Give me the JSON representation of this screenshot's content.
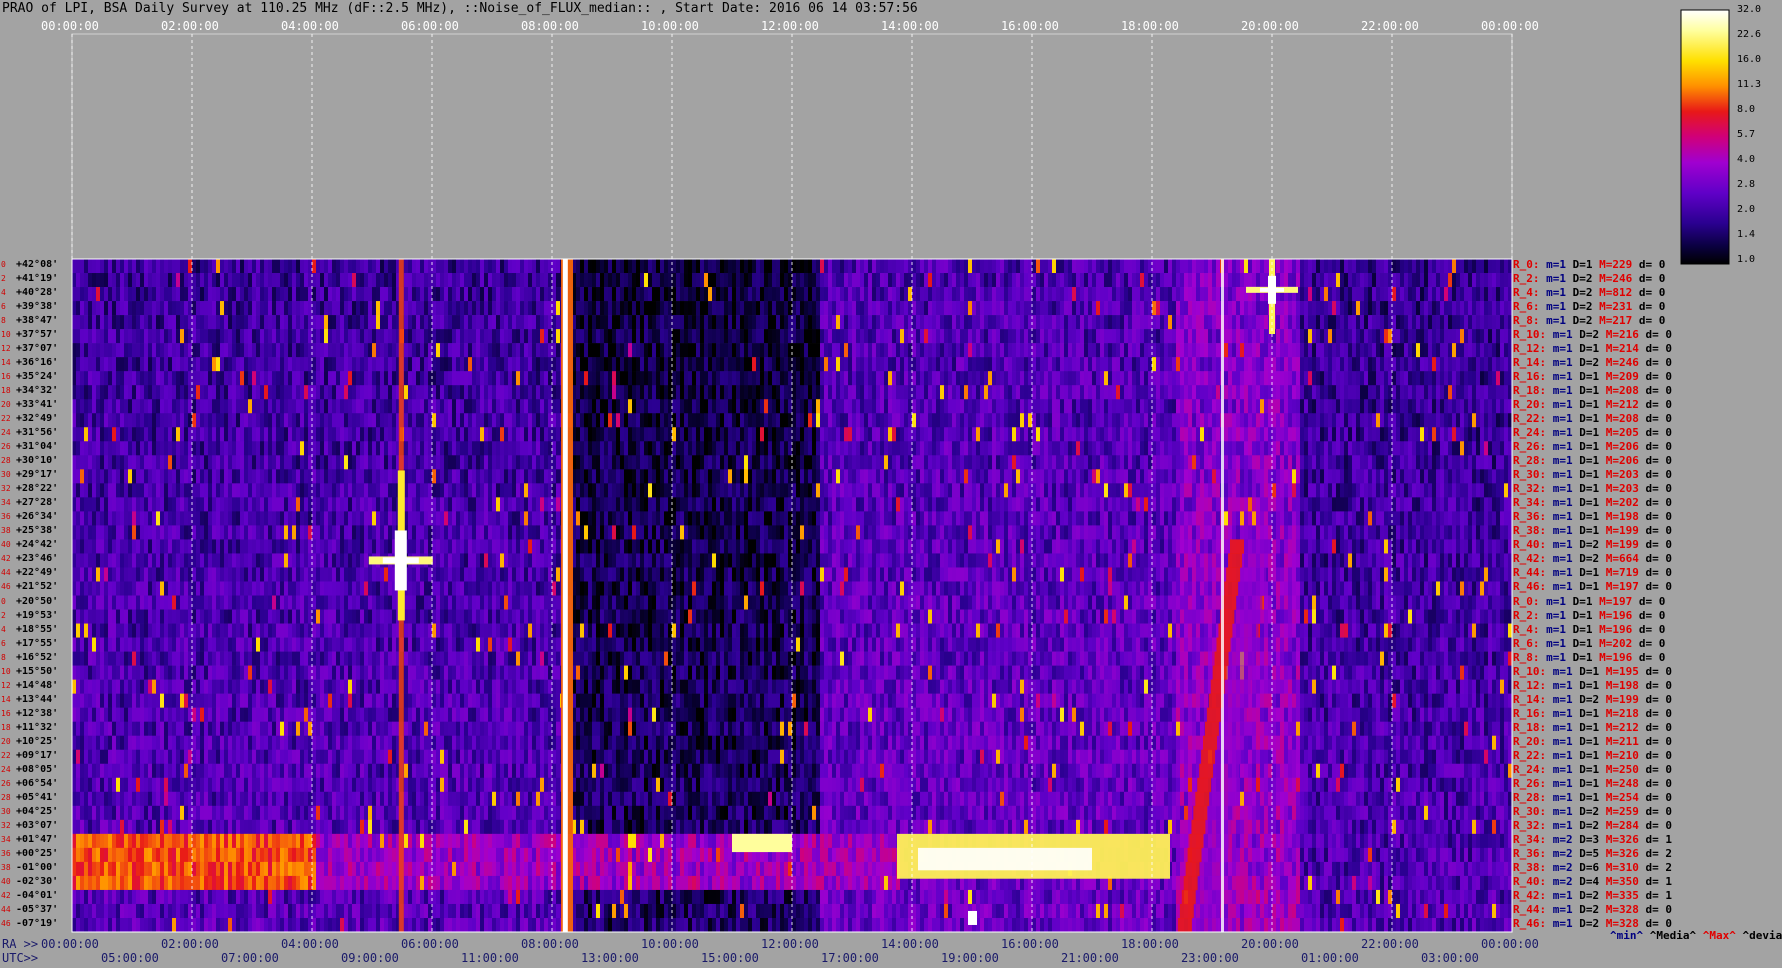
{
  "title": "PRAO of LPI, BSA Daily Survey at 110.25 MHz (dF::2.5 MHz), ::Noise_of_FLUX_median:: , Start Date: 2016 06 14 03:57:56",
  "top_axis_ticks": [
    "00:00:00",
    "02:00:00",
    "04:00:00",
    "06:00:00",
    "08:00:00",
    "10:00:00",
    "12:00:00",
    "14:00:00",
    "16:00:00",
    "18:00:00",
    "20:00:00",
    "22:00:00",
    "00:00:00"
  ],
  "ra_axis": {
    "label": "RA >>",
    "ticks": [
      "00:00:00",
      "02:00:00",
      "04:00:00",
      "06:00:00",
      "08:00:00",
      "10:00:00",
      "12:00:00",
      "14:00:00",
      "16:00:00",
      "18:00:00",
      "20:00:00",
      "22:00:00",
      "00:00:00"
    ]
  },
  "utc_axis": {
    "label": "UTC>>",
    "ticks": [
      "05:00:00",
      "07:00:00",
      "09:00:00",
      "11:00:00",
      "13:00:00",
      "15:00:00",
      "17:00:00",
      "19:00:00",
      "21:00:00",
      "23:00:00",
      "01:00:00",
      "03:00:00"
    ]
  },
  "colorbar": {
    "labels": [
      "32.0",
      "22.6",
      "16.0",
      "11.3",
      "8.0",
      "5.7",
      "4.0",
      "2.8",
      "2.0",
      "1.4",
      "1.0"
    ],
    "colors": [
      "#ffffff",
      "#ffff80",
      "#ffd800",
      "#ff8000",
      "#e01010",
      "#d0007a",
      "#a000d0",
      "#6000c8",
      "#2a0090",
      "#0a0040",
      "#000000"
    ]
  },
  "declinations": [
    "+42°08'",
    "+41°19'",
    "+40°28'",
    "+39°38'",
    "+38°47'",
    "+37°57'",
    "+37°07'",
    "+36°16'",
    "+35°24'",
    "+34°32'",
    "+33°41'",
    "+32°49'",
    "+31°56'",
    "+31°04'",
    "+30°10'",
    "+29°17'",
    "+28°22'",
    "+27°28'",
    "+26°34'",
    "+25°38'",
    "+24°42'",
    "+23°46'",
    "+22°49'",
    "+21°52'",
    "+20°50'",
    "+19°53'",
    "+18°55'",
    "+17°55'",
    "+16°52'",
    "+15°50'",
    "+14°48'",
    "+13°44'",
    "+12°38'",
    "+11°32'",
    "+10°25'",
    "+09°17'",
    "+08°05'",
    "+06°54'",
    "+05°41'",
    "+04°25'",
    "+03°07'",
    "+01°47'",
    "+00°25'",
    "-01°00'",
    "-02°30'",
    "-04°01'",
    "-05°37'",
    "-07°19'"
  ],
  "row_numbers": [
    "0",
    "2",
    "4",
    "6",
    "8",
    "10",
    "12",
    "14",
    "16",
    "18",
    "20",
    "22",
    "24",
    "26",
    "28",
    "30",
    "32",
    "34",
    "36",
    "38",
    "40",
    "42",
    "44",
    "46",
    "0",
    "2",
    "4",
    "6",
    "8",
    "10",
    "12",
    "14",
    "16",
    "18",
    "20",
    "22",
    "24",
    "26",
    "28",
    "30",
    "32",
    "34",
    "36",
    "38",
    "40",
    "42",
    "44",
    "46"
  ],
  "row_stats": [
    {
      "r": "R_0:",
      "m": "m=1",
      "d": "D=1",
      "M": "M=229",
      "dv": "d= 0"
    },
    {
      "r": "R_2:",
      "m": "m=1",
      "d": "D=2",
      "M": "M=246",
      "dv": "d= 0"
    },
    {
      "r": "R_4:",
      "m": "m=1",
      "d": "D=2",
      "M": "M=812",
      "dv": "d= 0"
    },
    {
      "r": "R_6:",
      "m": "m=1",
      "d": "D=2",
      "M": "M=231",
      "dv": "d= 0"
    },
    {
      "r": "R_8:",
      "m": "m=1",
      "d": "D=2",
      "M": "M=217",
      "dv": "d= 0"
    },
    {
      "r": "R_10:",
      "m": "m=1",
      "d": "D=2",
      "M": "M=216",
      "dv": "d= 0"
    },
    {
      "r": "R_12:",
      "m": "m=1",
      "d": "D=1",
      "M": "M=214",
      "dv": "d= 0"
    },
    {
      "r": "R_14:",
      "m": "m=1",
      "d": "D=2",
      "M": "M=246",
      "dv": "d= 0"
    },
    {
      "r": "R_16:",
      "m": "m=1",
      "d": "D=1",
      "M": "M=209",
      "dv": "d= 0"
    },
    {
      "r": "R_18:",
      "m": "m=1",
      "d": "D=1",
      "M": "M=208",
      "dv": "d= 0"
    },
    {
      "r": "R_20:",
      "m": "m=1",
      "d": "D=1",
      "M": "M=212",
      "dv": "d= 0"
    },
    {
      "r": "R_22:",
      "m": "m=1",
      "d": "D=1",
      "M": "M=208",
      "dv": "d= 0"
    },
    {
      "r": "R_24:",
      "m": "m=1",
      "d": "D=1",
      "M": "M=205",
      "dv": "d= 0"
    },
    {
      "r": "R_26:",
      "m": "m=1",
      "d": "D=1",
      "M": "M=206",
      "dv": "d= 0"
    },
    {
      "r": "R_28:",
      "m": "m=1",
      "d": "D=1",
      "M": "M=206",
      "dv": "d= 0"
    },
    {
      "r": "R_30:",
      "m": "m=1",
      "d": "D=1",
      "M": "M=203",
      "dv": "d= 0"
    },
    {
      "r": "R_32:",
      "m": "m=1",
      "d": "D=1",
      "M": "M=203",
      "dv": "d= 0"
    },
    {
      "r": "R_34:",
      "m": "m=1",
      "d": "D=1",
      "M": "M=202",
      "dv": "d= 0"
    },
    {
      "r": "R_36:",
      "m": "m=1",
      "d": "D=1",
      "M": "M=198",
      "dv": "d= 0"
    },
    {
      "r": "R_38:",
      "m": "m=1",
      "d": "D=1",
      "M": "M=199",
      "dv": "d= 0"
    },
    {
      "r": "R_40:",
      "m": "m=1",
      "d": "D=2",
      "M": "M=199",
      "dv": "d= 0"
    },
    {
      "r": "R_42:",
      "m": "m=1",
      "d": "D=2",
      "M": "M=664",
      "dv": "d= 0"
    },
    {
      "r": "R_44:",
      "m": "m=1",
      "d": "D=1",
      "M": "M=719",
      "dv": "d= 0"
    },
    {
      "r": "R_46:",
      "m": "m=1",
      "d": "D=1",
      "M": "M=197",
      "dv": "d= 0"
    },
    {
      "r": "R_0:",
      "m": "m=1",
      "d": "D=1",
      "M": "M=197",
      "dv": "d= 0"
    },
    {
      "r": "R_2:",
      "m": "m=1",
      "d": "D=1",
      "M": "M=196",
      "dv": "d= 0"
    },
    {
      "r": "R_4:",
      "m": "m=1",
      "d": "D=1",
      "M": "M=196",
      "dv": "d= 0"
    },
    {
      "r": "R_6:",
      "m": "m=1",
      "d": "D=1",
      "M": "M=202",
      "dv": "d= 0"
    },
    {
      "r": "R_8:",
      "m": "m=1",
      "d": "D=1",
      "M": "M=196",
      "dv": "d= 0"
    },
    {
      "r": "R_10:",
      "m": "m=1",
      "d": "D=1",
      "M": "M=195",
      "dv": "d= 0"
    },
    {
      "r": "R_12:",
      "m": "m=1",
      "d": "D=1",
      "M": "M=198",
      "dv": "d= 0"
    },
    {
      "r": "R_14:",
      "m": "m=1",
      "d": "D=2",
      "M": "M=199",
      "dv": "d= 0"
    },
    {
      "r": "R_16:",
      "m": "m=1",
      "d": "D=1",
      "M": "M=218",
      "dv": "d= 0"
    },
    {
      "r": "R_18:",
      "m": "m=1",
      "d": "D=1",
      "M": "M=212",
      "dv": "d= 0"
    },
    {
      "r": "R_20:",
      "m": "m=1",
      "d": "D=1",
      "M": "M=211",
      "dv": "d= 0"
    },
    {
      "r": "R_22:",
      "m": "m=1",
      "d": "D=1",
      "M": "M=210",
      "dv": "d= 0"
    },
    {
      "r": "R_24:",
      "m": "m=1",
      "d": "D=1",
      "M": "M=250",
      "dv": "d= 0"
    },
    {
      "r": "R_26:",
      "m": "m=1",
      "d": "D=1",
      "M": "M=248",
      "dv": "d= 0"
    },
    {
      "r": "R_28:",
      "m": "m=1",
      "d": "D=1",
      "M": "M=254",
      "dv": "d= 0"
    },
    {
      "r": "R_30:",
      "m": "m=1",
      "d": "D=2",
      "M": "M=259",
      "dv": "d= 0"
    },
    {
      "r": "R_32:",
      "m": "m=1",
      "d": "D=2",
      "M": "M=284",
      "dv": "d= 0"
    },
    {
      "r": "R_34:",
      "m": "m=2",
      "d": "D=3",
      "M": "M=326",
      "dv": "d= 1"
    },
    {
      "r": "R_36:",
      "m": "m=2",
      "d": "D=5",
      "M": "M=326",
      "dv": "d= 2"
    },
    {
      "r": "R_38:",
      "m": "m=2",
      "d": "D=6",
      "M": "M=310",
      "dv": "d= 2"
    },
    {
      "r": "R_40:",
      "m": "m=2",
      "d": "D=4",
      "M": "M=350",
      "dv": "d= 1"
    },
    {
      "r": "R_42:",
      "m": "m=1",
      "d": "D=2",
      "M": "M=335",
      "dv": "d= 1"
    },
    {
      "r": "R_44:",
      "m": "m=1",
      "d": "D=2",
      "M": "M=328",
      "dv": "d= 0"
    },
    {
      "r": "R_46:",
      "m": "m=1",
      "d": "D=2",
      "M": "M=328",
      "dv": "d= 0"
    }
  ],
  "legend": {
    "min": "^min^",
    "media": "^Media^",
    "max": "^Max^",
    "devia": "^devia^"
  },
  "chart_data": {
    "type": "heatmap",
    "title": "PRAO of LPI, BSA Daily Survey at 110.25 MHz (dF::2.5 MHz), ::Noise_of_FLUX_median:: , Start Date: 2016 06 14 03:57:56",
    "x_axis_top_ra": [
      "00:00:00",
      "02:00:00",
      "04:00:00",
      "06:00:00",
      "08:00:00",
      "10:00:00",
      "12:00:00",
      "14:00:00",
      "16:00:00",
      "18:00:00",
      "20:00:00",
      "22:00:00",
      "00:00:00"
    ],
    "x_axis_bottom_utc": [
      "05:00:00",
      "07:00:00",
      "09:00:00",
      "11:00:00",
      "13:00:00",
      "15:00:00",
      "17:00:00",
      "19:00:00",
      "21:00:00",
      "23:00:00",
      "01:00:00",
      "03:00:00"
    ],
    "y_axis_declination": "+42°08' to -07°19' (48 rows)",
    "color_scale": [
      1.0,
      1.4,
      2.0,
      2.8,
      4.0,
      5.7,
      8.0,
      11.3,
      16.0,
      22.6,
      32.0
    ],
    "log_scale": true,
    "grid": true,
    "features": [
      {
        "ra_hours": 5.5,
        "dec": "+23°46'",
        "level": 32.0,
        "desc": "bright cross"
      },
      {
        "ra_hours": 20.0,
        "dec": "+40°28'",
        "level": 32.0,
        "desc": "bright cross"
      },
      {
        "ra_hours": 8.2,
        "dec": "all rows",
        "level": 32.0,
        "desc": "vertical stripe"
      },
      {
        "ra_hours_range": [
          13.8,
          18.3
        ],
        "dec_range": [
          "+01°47'",
          "-02°30'"
        ],
        "level": 32.0,
        "desc": "bright band"
      },
      {
        "ra_hours_range": [
          0.0,
          4.0
        ],
        "dec_range": [
          "+01°47'",
          "-02°30'"
        ],
        "level": 8.0,
        "desc": "warm band"
      },
      {
        "ra_hours_range": [
          18.5,
          19.5
        ],
        "dec_range": [
          "+20°50'",
          "-07°19'"
        ],
        "level": 8.0,
        "desc": "diagonal galactic plane"
      }
    ]
  }
}
